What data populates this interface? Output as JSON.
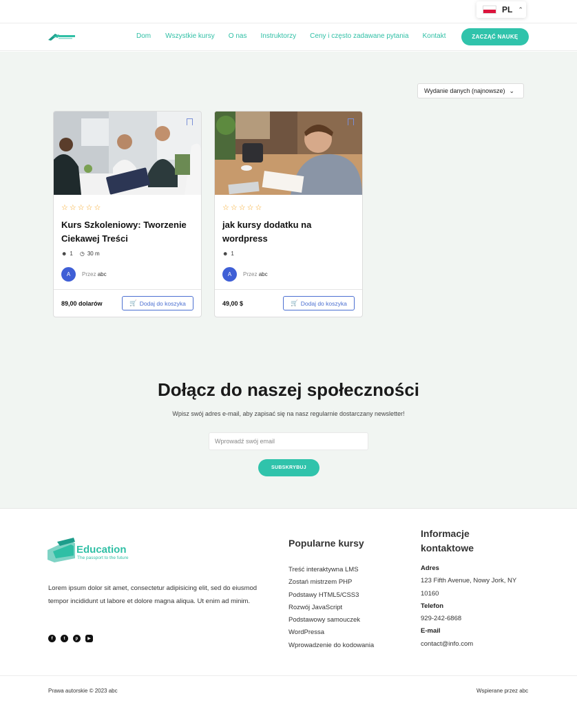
{
  "lang": {
    "code": "PL",
    "flag_colors": [
      "#ffffff",
      "#dc143c"
    ]
  },
  "header": {
    "nav": [
      "Dom",
      "Wszystkie kursy",
      "O nas",
      "Instruktorzy",
      "Ceny i często zadawane pytania",
      "Kontakt"
    ],
    "cta": "ZACZĄĆ NAUKĘ"
  },
  "sort": {
    "label": "Wydanie danych (najnowsze)"
  },
  "courses": [
    {
      "title": "Kurs Szkoleniowy: Tworzenie Ciekawej Treści",
      "students": "1",
      "duration": "30 m",
      "avatar": "A",
      "by_label": "Przez",
      "author": "abc",
      "price": "89,00 dolarów",
      "cart": "Dodaj do koszyka"
    },
    {
      "title": "jak kursy dodatku na wordpress",
      "students": "1",
      "avatar": "A",
      "by_label": "Przez",
      "author": "abc",
      "price": "49,00 $",
      "cart": "Dodaj do koszyka"
    }
  ],
  "newsletter": {
    "title": "Dołącz do naszej społeczności",
    "subtitle": "Wpisz swój adres e-mail, aby zapisać się na nasz regularnie dostarczany newsletter!",
    "placeholder": "Wprowadź swój email",
    "button": "SUBSKRYBUJ"
  },
  "footer": {
    "logo_word": "Education",
    "logo_tagline": "The passport to the future",
    "description": "Lorem ipsum dolor sit amet, consectetur adipisicing elit, sed do eiusmod tempor incididunt ut labore et dolore magna aliqua. Ut enim ad minim.",
    "popular_title": "Popularne kursy",
    "popular_courses": [
      "Treść interaktywna LMS",
      "Zostań mistrzem PHP",
      "Podstawy HTML5/CSS3",
      "Rozwój JavaScript",
      "Podstawowy samouczek WordPressa",
      "Wprowadzenie do kodowania"
    ],
    "contact_title": "Informacje kontaktowe",
    "address_label": "Adres",
    "address": "123 Fifth Avenue, Nowy Jork, NY 10160",
    "phone_label": "Telefon",
    "phone": "929-242-6868",
    "email_label": "E-mail",
    "email": "contact@info.com",
    "copyright": "Prawa autorskie © 2023 abc",
    "powered": "Wspierane przez abc"
  },
  "colors": {
    "accent": "#30c3ab",
    "link_blue": "#4b6fd1",
    "star": "#f5a623"
  }
}
